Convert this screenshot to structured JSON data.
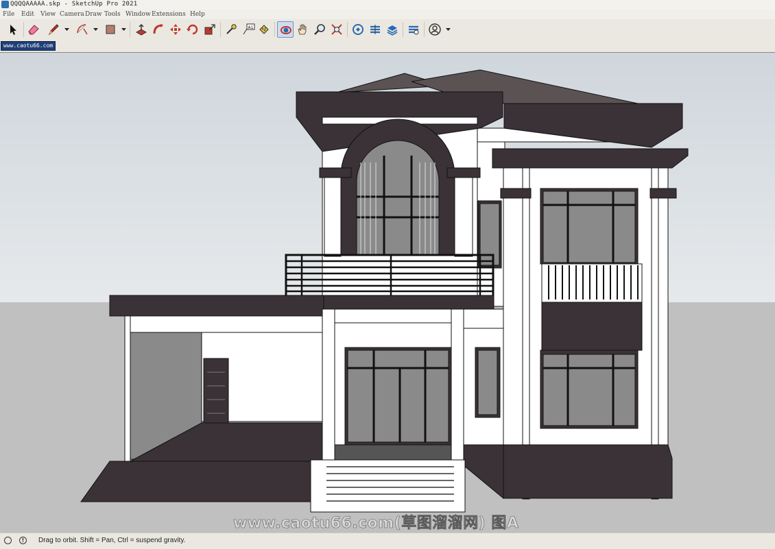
{
  "window": {
    "title": "QQQQAAAAA.skp - SketchUp Pro 2021"
  },
  "menu": [
    "File",
    "Edit",
    "View",
    "Camera",
    "Draw",
    "Tools",
    "Window",
    "Extensions",
    "Help"
  ],
  "toolbar": {
    "tools": [
      "select",
      "eraser",
      "line",
      "arc",
      "rectangle",
      "push-pull",
      "follow-me",
      "move",
      "rotate",
      "scale",
      "tape-measure",
      "text",
      "paint-bucket",
      "orbit",
      "pan",
      "zoom",
      "zoom-extents",
      "3d-warehouse",
      "extension-warehouse",
      "layout",
      "extension-manager",
      "account"
    ],
    "active_tool": "orbit"
  },
  "scene_tab": {
    "label": "www.caotu66.com"
  },
  "viewport": {
    "colors": {
      "sky_top": "#cfd6dc",
      "sky_bottom": "#e6e9eb",
      "ground": "#c0c0c0",
      "trim": "#3a3236",
      "wall": "#ffffff",
      "glass": "#7a7a7a"
    }
  },
  "watermark": {
    "text": "www.caotu66.com(草图溜溜网) 图A"
  },
  "status": {
    "text": "Drag to orbit. Shift = Pan, Ctrl = suspend gravity."
  }
}
